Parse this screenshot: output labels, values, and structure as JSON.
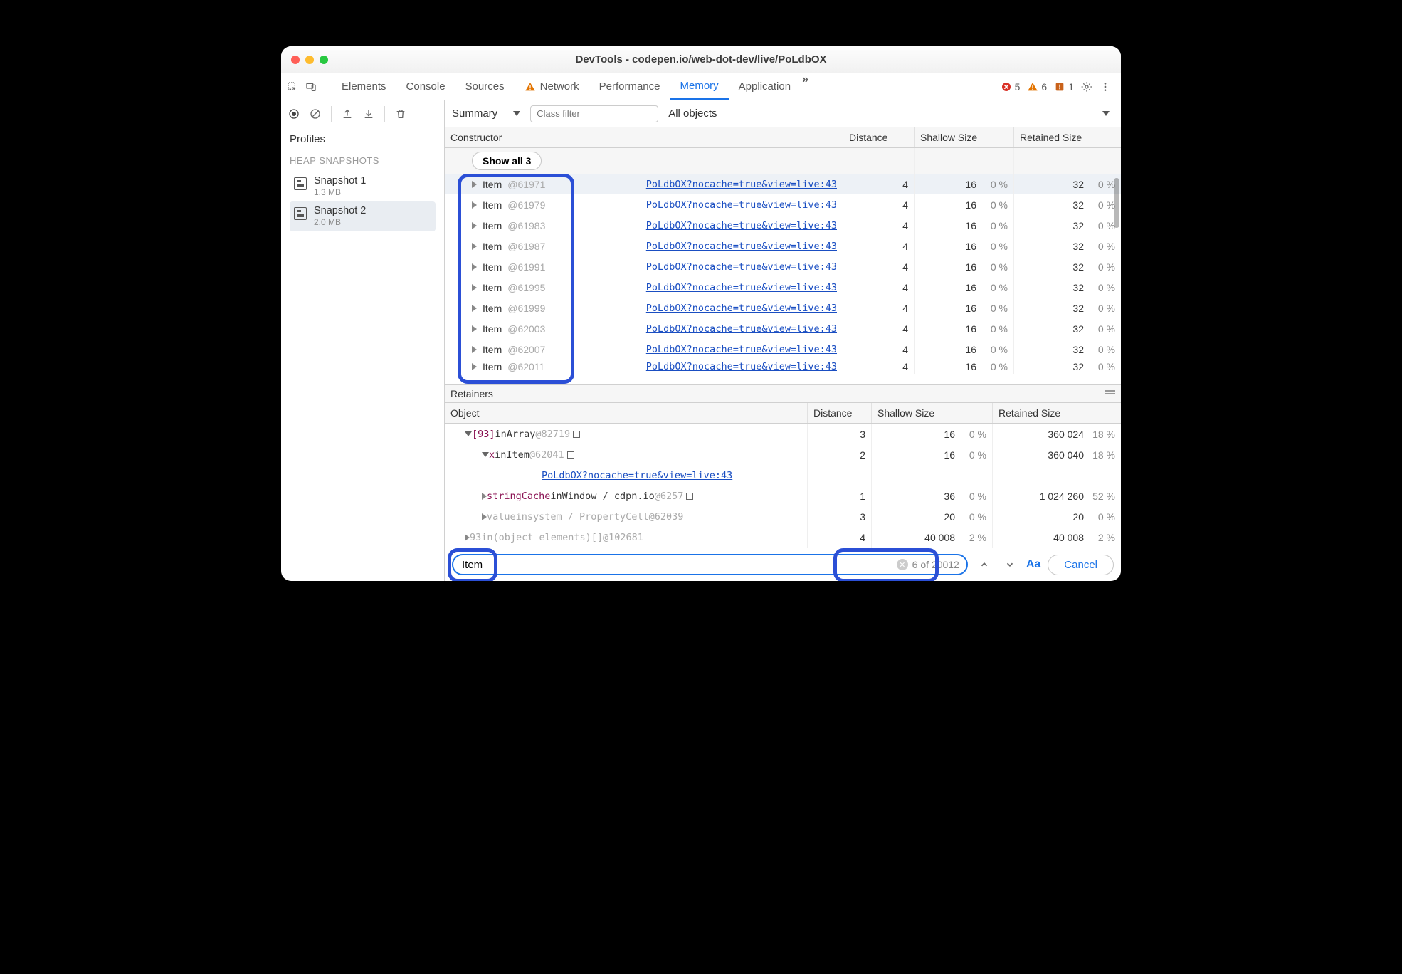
{
  "window": {
    "title": "DevTools - codepen.io/web-dot-dev/live/PoLdbOX"
  },
  "tabs": {
    "items": [
      "Elements",
      "Console",
      "Sources",
      "Network",
      "Performance",
      "Memory",
      "Application"
    ],
    "active": "Memory",
    "warningTab": "Network",
    "overflow": "»"
  },
  "badges": {
    "errors": "5",
    "warnings": "6",
    "issues": "1"
  },
  "subbar": {
    "summary_label": "Summary",
    "class_filter_placeholder": "Class filter",
    "objects_label": "All objects"
  },
  "sidebar": {
    "title": "Profiles",
    "section": "HEAP SNAPSHOTS",
    "snapshots": [
      {
        "name": "Snapshot 1",
        "size": "1.3 MB"
      },
      {
        "name": "Snapshot 2",
        "size": "2.0 MB"
      }
    ],
    "selected_index": 1
  },
  "main_headers": {
    "ctor": "Constructor",
    "dist": "Distance",
    "shallow": "Shallow Size",
    "retained": "Retained Size"
  },
  "show_all_label": "Show all 3",
  "source_link": "PoLdbOX?nocache=true&view=live:43",
  "rows": [
    {
      "name": "Item",
      "id": "@61971",
      "dist": "4",
      "shallow": "16",
      "spct": "0 %",
      "retained": "32",
      "rpct": "0 %",
      "hl": true
    },
    {
      "name": "Item",
      "id": "@61979",
      "dist": "4",
      "shallow": "16",
      "spct": "0 %",
      "retained": "32",
      "rpct": "0 %"
    },
    {
      "name": "Item",
      "id": "@61983",
      "dist": "4",
      "shallow": "16",
      "spct": "0 %",
      "retained": "32",
      "rpct": "0 %"
    },
    {
      "name": "Item",
      "id": "@61987",
      "dist": "4",
      "shallow": "16",
      "spct": "0 %",
      "retained": "32",
      "rpct": "0 %"
    },
    {
      "name": "Item",
      "id": "@61991",
      "dist": "4",
      "shallow": "16",
      "spct": "0 %",
      "retained": "32",
      "rpct": "0 %"
    },
    {
      "name": "Item",
      "id": "@61995",
      "dist": "4",
      "shallow": "16",
      "spct": "0 %",
      "retained": "32",
      "rpct": "0 %"
    },
    {
      "name": "Item",
      "id": "@61999",
      "dist": "4",
      "shallow": "16",
      "spct": "0 %",
      "retained": "32",
      "rpct": "0 %"
    },
    {
      "name": "Item",
      "id": "@62003",
      "dist": "4",
      "shallow": "16",
      "spct": "0 %",
      "retained": "32",
      "rpct": "0 %"
    },
    {
      "name": "Item",
      "id": "@62007",
      "dist": "4",
      "shallow": "16",
      "spct": "0 %",
      "retained": "32",
      "rpct": "0 %"
    },
    {
      "name": "Item",
      "id": "@62011",
      "dist": "4",
      "shallow": "16",
      "spct": "0 %",
      "retained": "32",
      "rpct": "0 %",
      "partial": true
    }
  ],
  "retainers": {
    "title": "Retainers",
    "headers": {
      "obj": "Object",
      "dist": "Distance",
      "shallow": "Shallow Size",
      "retained": "Retained Size"
    },
    "rows": [
      {
        "indent": 1,
        "open": true,
        "pre": "[93]",
        "mid": " in ",
        "post": "Array ",
        "id": "@82719",
        "sq": true,
        "dist": "3",
        "shallow": "16",
        "spct": "0 %",
        "retained": "360 024",
        "rpct": "18 %"
      },
      {
        "indent": 2,
        "open": true,
        "pre": "x",
        "mid": " in ",
        "post": "Item ",
        "id": "@62041",
        "sq": true,
        "dist": "2",
        "shallow": "16",
        "spct": "0 %",
        "retained": "360 040",
        "rpct": "18 %"
      },
      {
        "indent": 3,
        "linkonly": true
      },
      {
        "indent": 2,
        "open": false,
        "pre": "stringCache",
        "mid": " in ",
        "post": "Window / cdpn.io ",
        "id": "@6257",
        "sq": true,
        "dist": "1",
        "shallow": "36",
        "spct": "0 %",
        "retained": "1 024 260",
        "rpct": "52 %"
      },
      {
        "indent": 2,
        "open": false,
        "grey": true,
        "pre": "value",
        "mid": " in ",
        "post": "system / PropertyCell ",
        "id": "@62039",
        "dist": "3",
        "shallow": "20",
        "spct": "0 %",
        "retained": "20",
        "rpct": "0 %"
      },
      {
        "indent": 1,
        "open": false,
        "grey": true,
        "pre": "93",
        "mid": " in ",
        "post": "(object elements)[] ",
        "id": "@102681",
        "dist": "4",
        "shallow": "40 008",
        "spct": "2 %",
        "retained": "40 008",
        "rpct": "2 %"
      }
    ]
  },
  "search": {
    "value": "Item",
    "count": "6 of 20012",
    "aa": "Aa",
    "cancel": "Cancel"
  }
}
